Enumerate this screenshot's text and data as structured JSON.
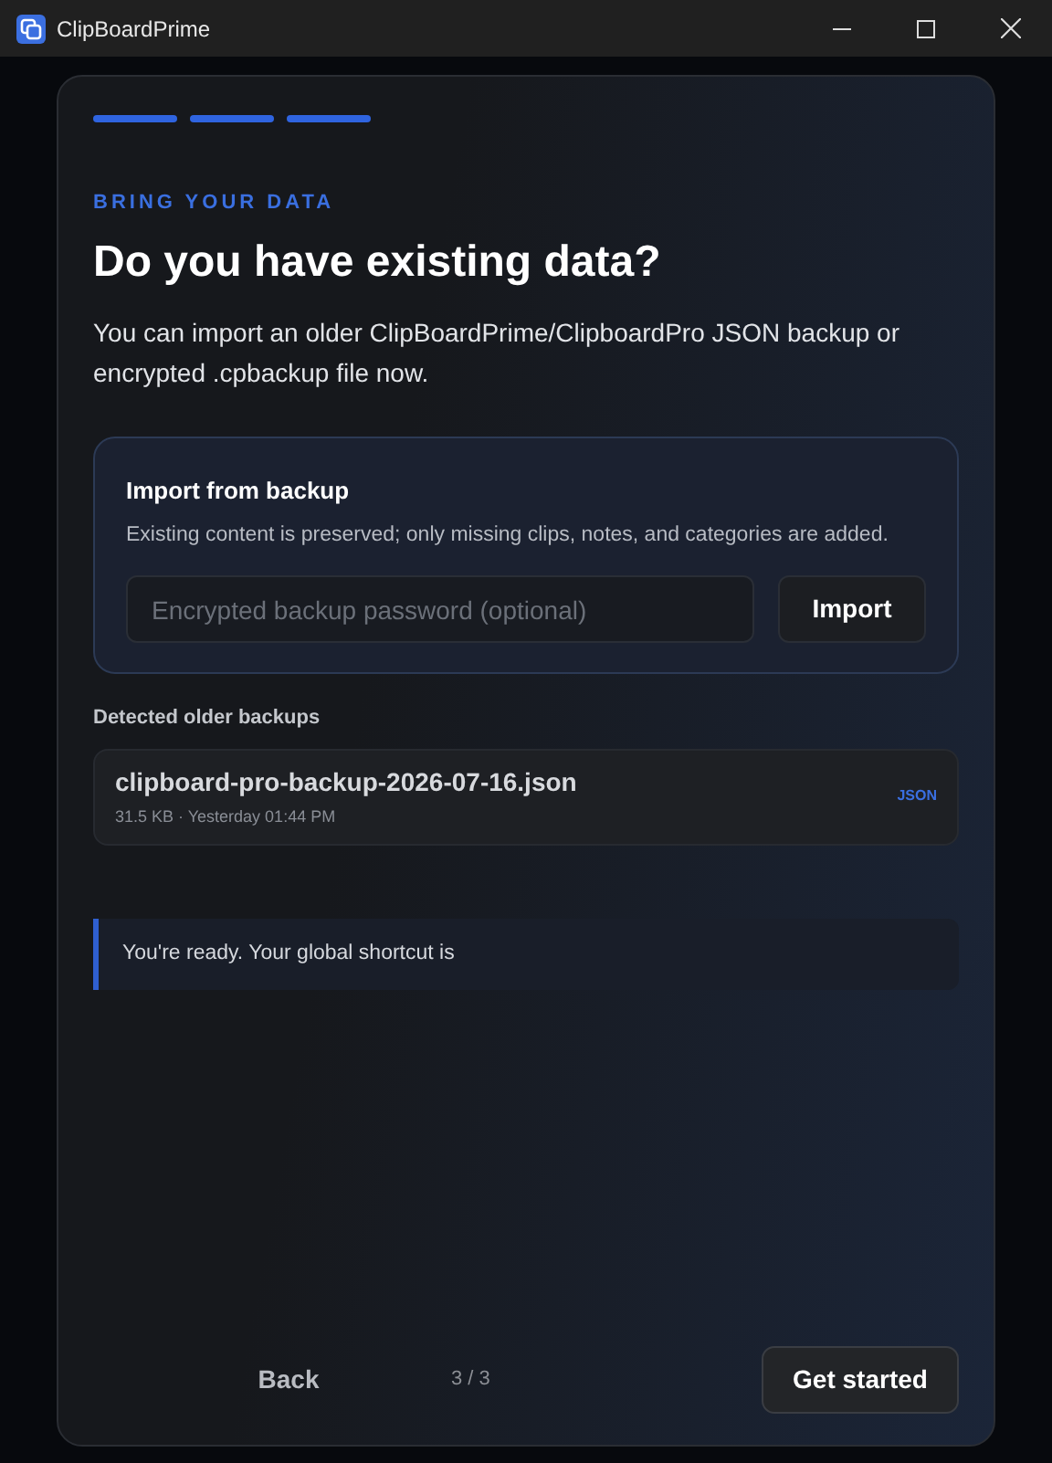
{
  "window": {
    "title": "ClipBoardPrime"
  },
  "steps": [
    {
      "done": true
    },
    {
      "done": true
    },
    {
      "done": true
    }
  ],
  "eyebrow": "BRING YOUR DATA",
  "heading": "Do you have existing data?",
  "description": "You can import an older ClipBoardPrime/ClipboardPro JSON backup or encrypted .cpbackup file now.",
  "import_panel": {
    "title": "Import from backup",
    "note": "Existing content is preserved; only missing clips, notes, and categories are added.",
    "password": {
      "placeholder": "Encrypted backup password (optional)"
    },
    "button": "Import"
  },
  "backups": {
    "label": "Detected older backups",
    "items": [
      {
        "name": "clipboard-pro-backup-2026-07-16.json",
        "meta": "31.5 KB · Yesterday 01:44 PM",
        "format": "JSON"
      }
    ]
  },
  "notice": "You're ready. Your global shortcut is",
  "footer": {
    "back": "Back",
    "page": "3 / 3",
    "next": "Get started"
  }
}
